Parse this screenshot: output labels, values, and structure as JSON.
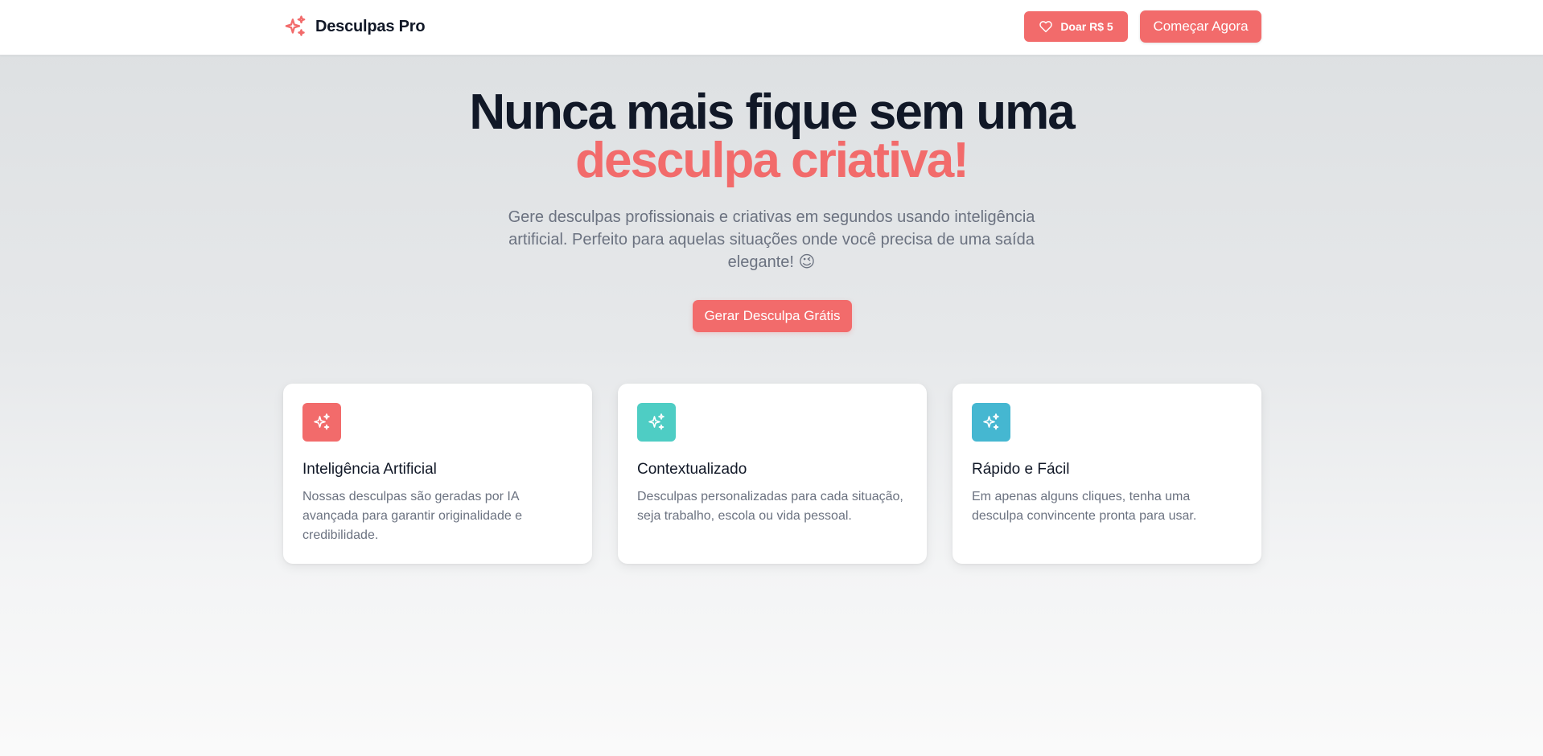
{
  "header": {
    "brand": "Desculpas Pro",
    "brand_icon": "sparkles-icon",
    "donate_label": "Doar R$ 5",
    "donate_icon": "heart-icon",
    "start_label": "Começar Agora"
  },
  "hero": {
    "title_line1": "Nunca mais fique sem uma",
    "title_line2": "desculpa criativa!",
    "subtitle": "Gere desculpas profissionais e criativas em segundos usando inteligência artificial. Perfeito para aquelas situações onde você precisa de uma saída elegante! 😉",
    "cta_label": "Gerar Desculpa Grátis"
  },
  "features": [
    {
      "icon": "sparkles-icon",
      "color": "#f26b6b",
      "title": "Inteligência Artificial",
      "description": "Nossas desculpas são geradas por IA avançada para garantir originalidade e credibilidade."
    },
    {
      "icon": "sparkles-icon",
      "color": "#4ecdc4",
      "title": "Contextualizado",
      "description": "Desculpas personalizadas para cada situação, seja trabalho, escola ou vida pessoal."
    },
    {
      "icon": "sparkles-icon",
      "color": "#45b7d1",
      "title": "Rápido e Fácil",
      "description": "Em apenas alguns cliques, tenha uma desculpa convincente pronta para usar."
    }
  ],
  "colors": {
    "accent": "#f26b6b",
    "teal": "#4ecdc4",
    "blue": "#45b7d1",
    "heading": "#111827",
    "muted": "#6b7280"
  }
}
